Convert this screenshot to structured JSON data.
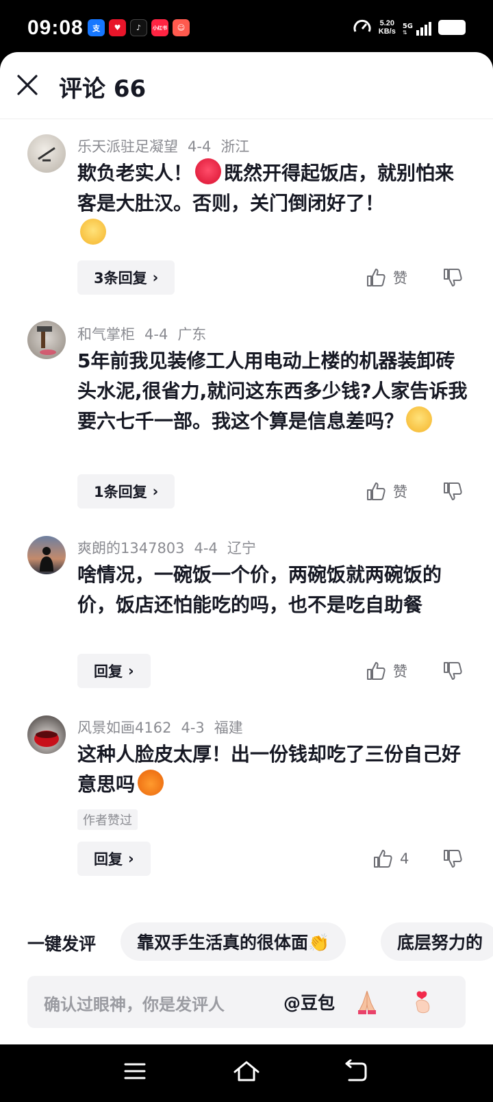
{
  "status_bar": {
    "time": "09:08",
    "app_icons": [
      {
        "name": "alipay-icon",
        "glyph": "支",
        "color": "#1677ff"
      },
      {
        "name": "heart-app-icon",
        "glyph": "♥",
        "color": "#e8152a"
      },
      {
        "name": "tiktok-icon",
        "glyph": "♪",
        "color": "#111111"
      },
      {
        "name": "xiaohongshu-icon",
        "glyph": "小红书",
        "color": "#ff2442"
      },
      {
        "name": "clown-app-icon",
        "glyph": "☺",
        "color": "#ff5a4e"
      }
    ],
    "speed_value": "5.20",
    "speed_unit": "KB/s",
    "network": "5G"
  },
  "header": {
    "title": "评论 66"
  },
  "comments": [
    {
      "username": "乐天派驻足凝望",
      "date": "4-4",
      "location": "浙江",
      "text": "欺负老实人！",
      "text2": "既然开得起饭店，就别怕来客是大肚汉。否则，关门倒闭好了！",
      "reply_label": "3条回复",
      "like_label": "赞"
    },
    {
      "username": "和气掌柜",
      "date": "4-4",
      "location": "广东",
      "text": "5年前我见装修工人用电动上楼的机器装卸砖头水泥,很省力,就问这东西多少钱?人家告诉我要六七千一部。我这个算是信息差吗？",
      "reply_label": "1条回复",
      "like_label": "赞"
    },
    {
      "username": "爽朗的1347803",
      "date": "4-4",
      "location": "辽宁",
      "text": "啥情况，一碗饭一个价，两碗饭就两碗饭的价，饭店还怕能吃的吗，也不是吃自助餐",
      "reply_label": "回复",
      "like_label": "赞"
    },
    {
      "username": "风景如画4162",
      "date": "4-3",
      "location": "福建",
      "text": "这种人脸皮太厚！出一份钱却吃了三份自己好意思吗",
      "badge": "作者赞过",
      "reply_label": "回复",
      "like_count": "4"
    }
  ],
  "quick_comment": {
    "label": "一键发评",
    "chips": [
      "靠双手生活真的很体面👏",
      "底层努力的"
    ]
  },
  "input": {
    "placeholder": "确认过眼神，你是发评人",
    "at_label": "@豆包"
  }
}
